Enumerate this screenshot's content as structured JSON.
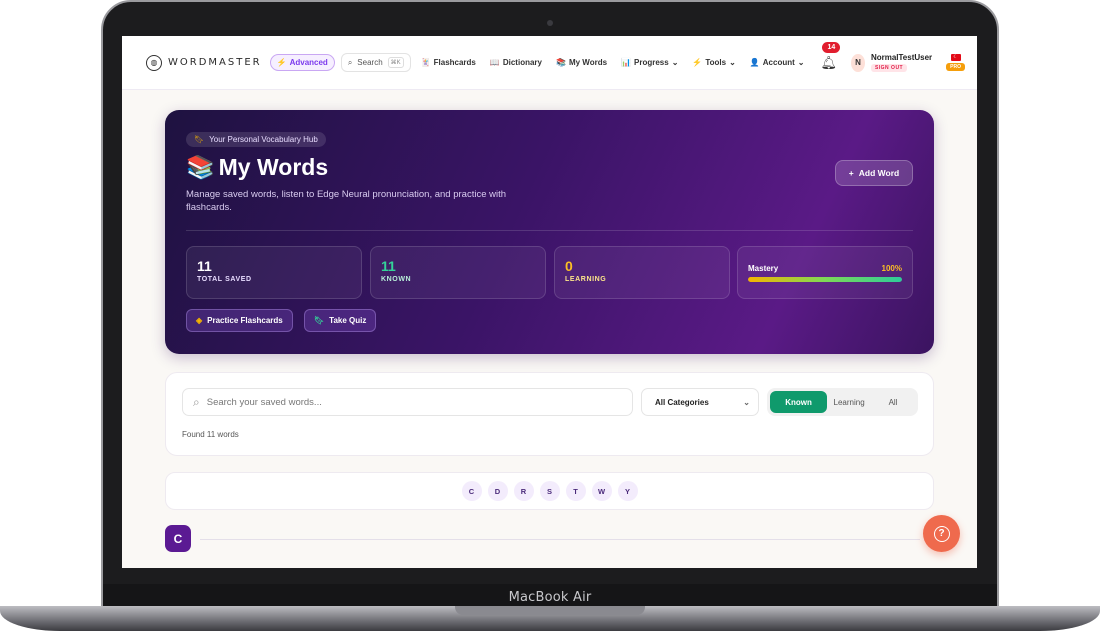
{
  "device": {
    "label": "MacBook Air"
  },
  "nav": {
    "brand": "WORDMASTER",
    "level_badge": "Advanced",
    "search_label": "Search",
    "search_shortcut": "⌘K",
    "links": {
      "flashcards": "Flashcards",
      "dictionary": "Dictionary",
      "my_words": "My Words",
      "progress": "Progress",
      "tools": "Tools",
      "account": "Account"
    },
    "notification_count": "14",
    "avatar_initial": "N",
    "username": "NormalTestUser",
    "sign_out": "SIGN OUT",
    "plan_badge": "PRO"
  },
  "hero": {
    "tag": "Your Personal Vocabulary Hub",
    "title_emoji": "📚",
    "title": "My Words",
    "description": "Manage saved words, listen to Edge Neural pronunciation, and practice with flashcards.",
    "add_word": "Add Word",
    "stats": {
      "total_saved": {
        "value": "11",
        "label": "TOTAL SAVED",
        "color": "#ffffff"
      },
      "known": {
        "value": "11",
        "label": "KNOWN",
        "color": "#34d399"
      },
      "learning": {
        "value": "0",
        "label": "LEARNING",
        "color": "#fbbf24"
      }
    },
    "mastery": {
      "label": "Mastery",
      "value_text": "100%",
      "fraction": 1.0
    },
    "practice_flashcards": "Practice Flashcards",
    "take_quiz": "Take Quiz"
  },
  "filters": {
    "search_placeholder": "Search your saved words...",
    "category": "All Categories",
    "segments": [
      "Known",
      "Learning",
      "All"
    ],
    "active_segment": "Known",
    "found_text": "Found 11 words"
  },
  "letters": [
    "C",
    "D",
    "R",
    "S",
    "T",
    "W",
    "Y"
  ],
  "section": {
    "letter": "C"
  },
  "colors": {
    "accent": "#5b1a93",
    "known_green": "#0f9a6c",
    "help": "#ef6a4d"
  }
}
